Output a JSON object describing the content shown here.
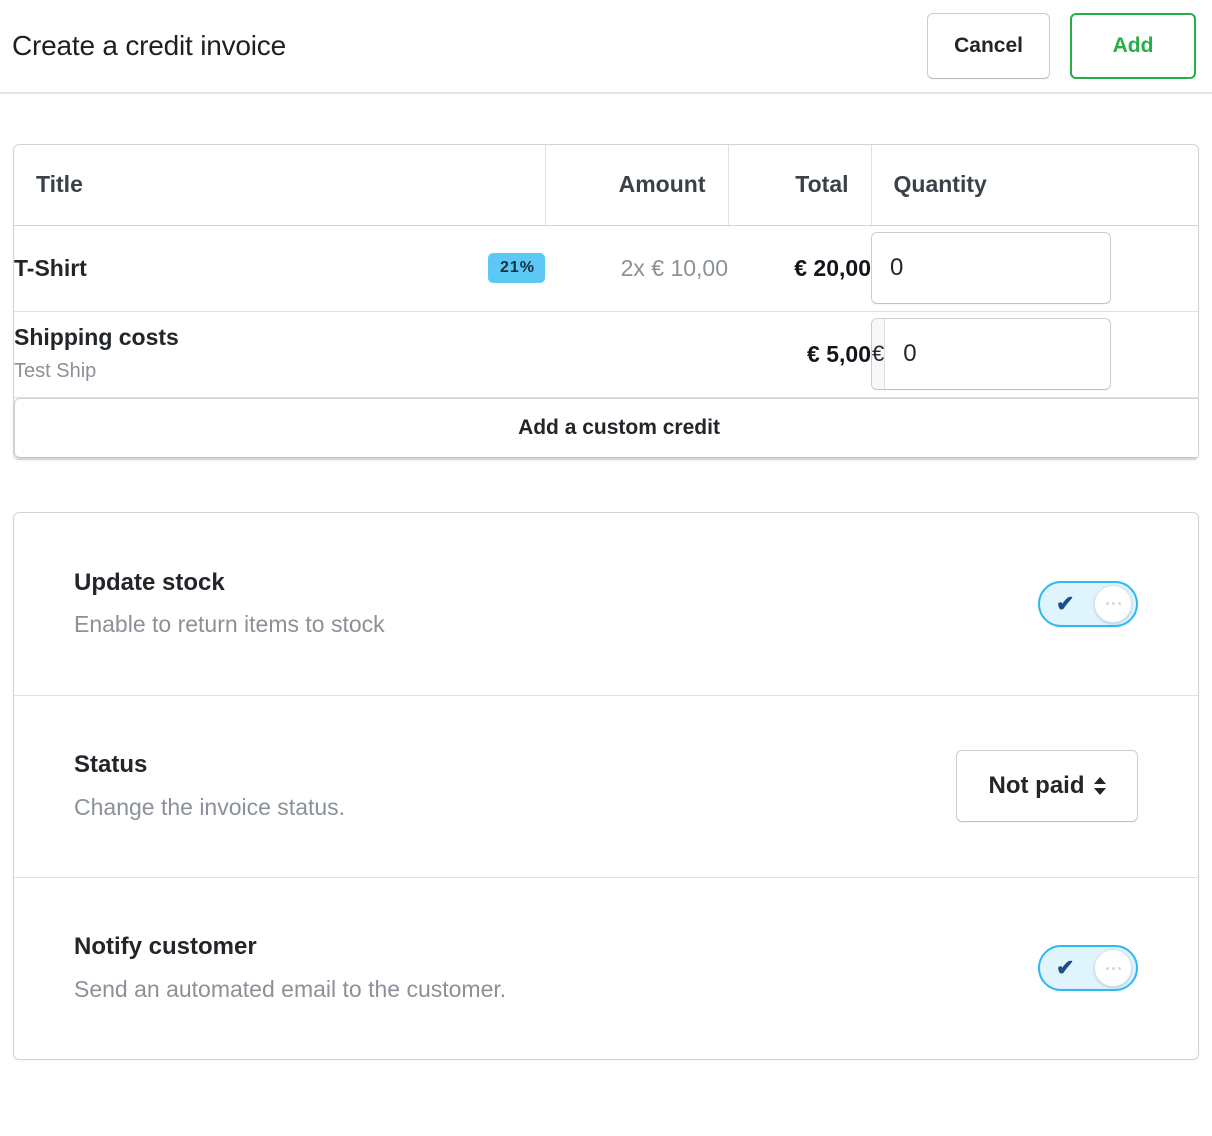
{
  "header": {
    "title": "Create a credit invoice",
    "cancel_label": "Cancel",
    "add_label": "Add"
  },
  "items_table": {
    "columns": {
      "title": "Title",
      "amount": "Amount",
      "total": "Total",
      "quantity": "Quantity"
    },
    "rows": [
      {
        "name": "T-Shirt",
        "subtitle": "",
        "tax_badge": "21%",
        "amount": "2x € 10,00",
        "total": "€ 20,00",
        "quantity_value": "0",
        "currency_prefix": ""
      },
      {
        "name": "Shipping costs",
        "subtitle": "Test Ship",
        "tax_badge": "",
        "amount": "",
        "total": "€ 5,00",
        "quantity_value": "0",
        "currency_prefix": "€"
      }
    ],
    "add_custom_credit_label": "Add a custom credit"
  },
  "settings": {
    "rows": [
      {
        "title": "Update stock",
        "description": "Enable to return items to stock",
        "control": "toggle",
        "toggle_on": true
      },
      {
        "title": "Status",
        "description": "Change the invoice status.",
        "control": "select",
        "select_value": "Not paid"
      },
      {
        "title": "Notify customer",
        "description": "Send an automated email to the customer.",
        "control": "toggle",
        "toggle_on": true
      }
    ]
  },
  "colors": {
    "accent_green": "#27ae48",
    "badge_blue": "#5bc8f5",
    "toggle_border": "#2fb9f0",
    "toggle_track": "#e0f4fd",
    "check_navy": "#1b4f8c",
    "muted_text": "#8b9198",
    "border": "#cfd5da"
  }
}
